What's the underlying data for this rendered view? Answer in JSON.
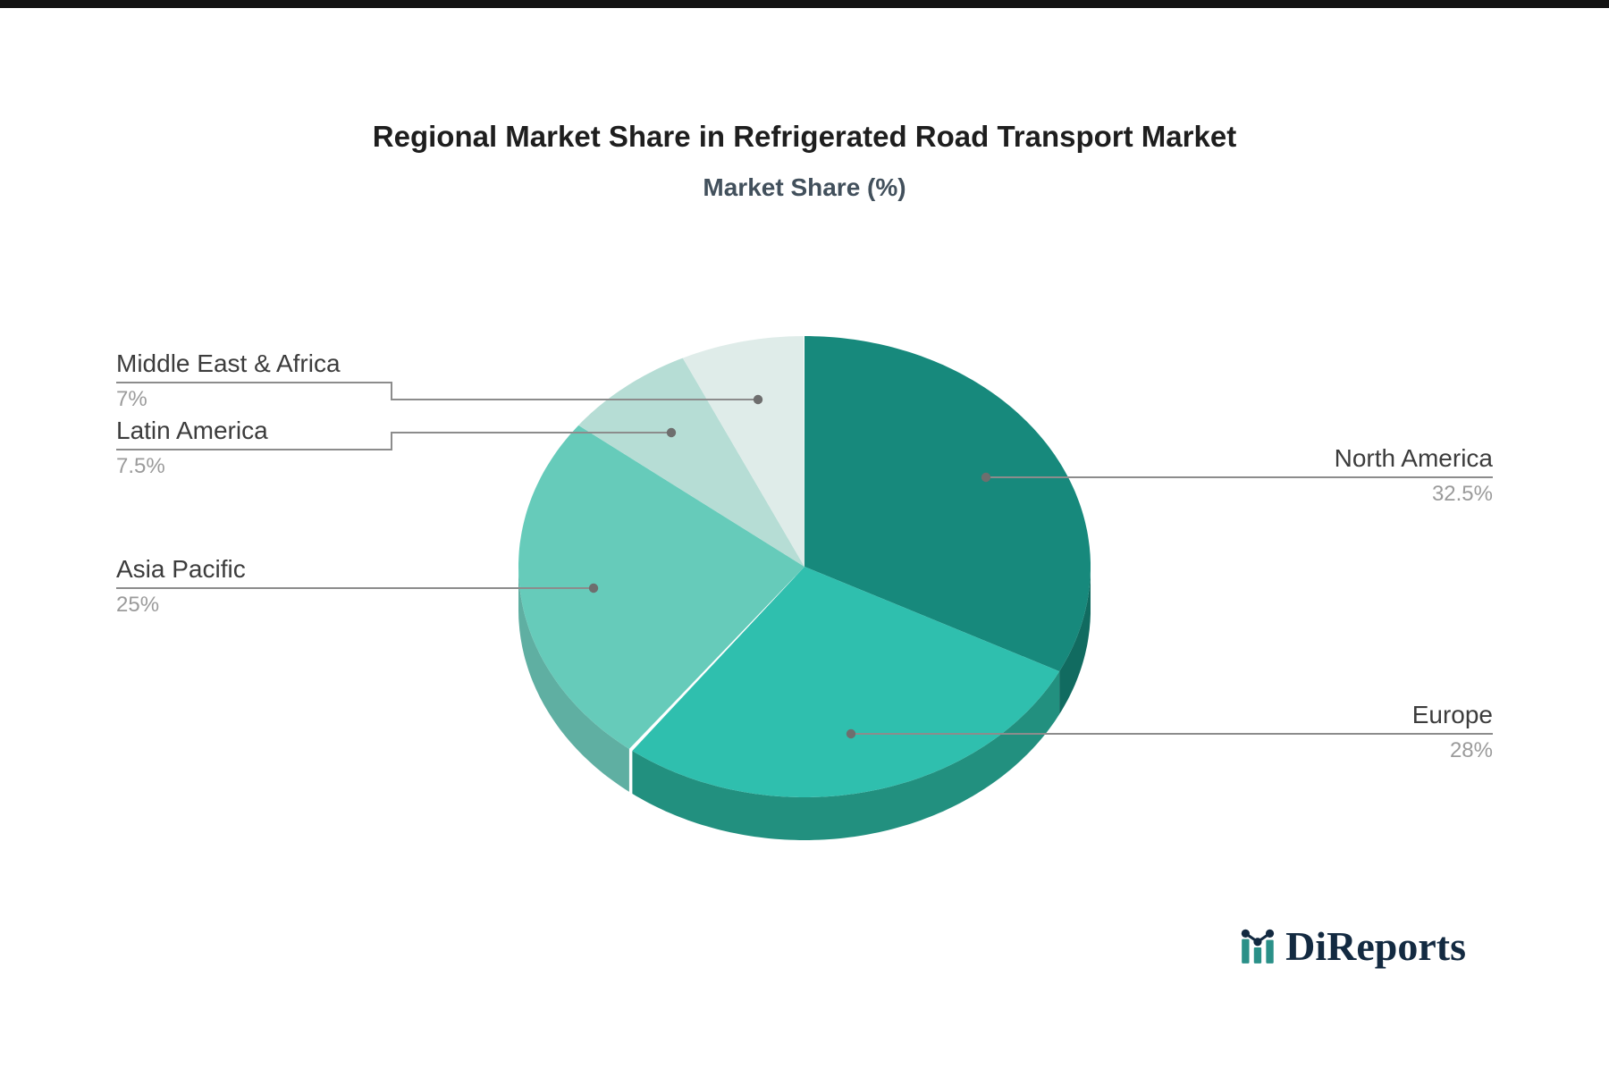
{
  "page": {
    "background": "#ffffff",
    "top_edge_color": "#131313"
  },
  "chart_data": {
    "type": "pie",
    "title": "Regional Market Share in Refrigerated Road Transport Market",
    "subtitle": "Market Share (%)",
    "unit": "%",
    "style": "3d-pie",
    "start_angle_deg": 0,
    "clockwise": true,
    "slices": [
      {
        "label": "North America",
        "value": 32.5,
        "display": "32.5%",
        "color": "#17897C",
        "side_color": "#116B60",
        "label_side": "right"
      },
      {
        "label": "Europe",
        "value": 28,
        "display": "28%",
        "color": "#2FBFAE",
        "side_color": "#22907F",
        "label_side": "right"
      },
      {
        "label": "Asia Pacific",
        "value": 25,
        "display": "25%",
        "color": "#66CBBA",
        "side_color": "#5FAFA2",
        "label_side": "left"
      },
      {
        "label": "Latin America",
        "value": 7.5,
        "display": "7.5%",
        "color": "#B6DDD5",
        "side_color": "#9CCDC3",
        "label_side": "left"
      },
      {
        "label": "Middle East & Africa",
        "value": 7,
        "display": "7%",
        "color": "#DFECE9",
        "side_color": "#C5DDD7",
        "label_side": "left"
      }
    ],
    "colors": {
      "leader_line": "#8C8C8C",
      "dot": "#6E6E6E",
      "label_text": "#3C3C3C",
      "value_text": "#9B9B9B",
      "title_text": "#1E1E1E",
      "subtitle_text": "#42505C"
    },
    "legend": "none",
    "labels_layout": "leader-lines"
  },
  "branding": {
    "logo_text": "DiReports",
    "logo_text_color": "#132A41",
    "logo_mark_color": "#2A9088"
  }
}
